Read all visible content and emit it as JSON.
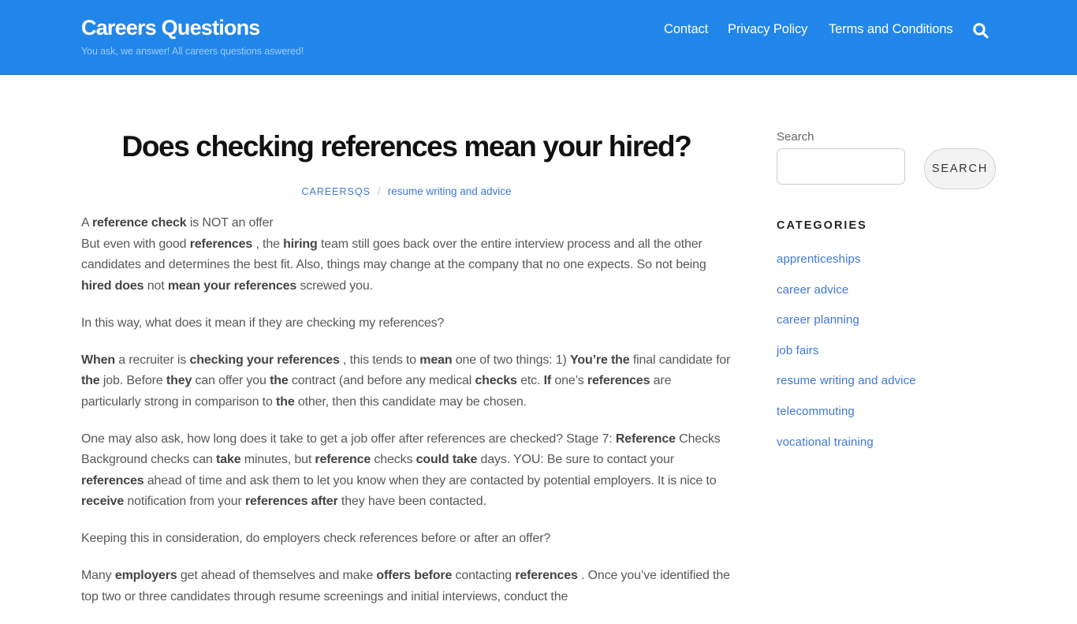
{
  "header": {
    "site_title": "Careers Questions",
    "tagline": "You ask, we answer! All careers questions aswered!",
    "nav": [
      {
        "label": "Contact"
      },
      {
        "label": "Privacy Policy"
      },
      {
        "label": "Terms and Conditions"
      }
    ],
    "search_icon": "search-icon",
    "colors": {
      "bar": "#2186ea",
      "tagline": "#9ccbfa"
    }
  },
  "article": {
    "title": "Does checking references mean your hired?",
    "meta": {
      "author": "CAREERSQS",
      "separator": "/",
      "category": "resume writing and advice"
    },
    "paragraphs": [
      [
        {
          "t": "A "
        },
        {
          "b": "reference check"
        },
        {
          "t": " is NOT an offer"
        },
        {
          "br": true
        },
        {
          "t": "But even with good "
        },
        {
          "b": "references"
        },
        {
          "t": " , the "
        },
        {
          "b": "hiring"
        },
        {
          "t": " team still goes back over the entire interview process and all the other candidates and determines the best fit. Also, things may change at the company that no one expects. So not being "
        },
        {
          "b": "hired does"
        },
        {
          "t": " not "
        },
        {
          "b": "mean your references"
        },
        {
          "t": " screwed you."
        }
      ],
      [
        {
          "t": "In this way, what does it mean if they are checking my references?"
        }
      ],
      [
        {
          "b": "When"
        },
        {
          "t": " a recruiter is "
        },
        {
          "b": "checking your references"
        },
        {
          "t": " , this tends to "
        },
        {
          "b": "mean"
        },
        {
          "t": " one of two things: 1) "
        },
        {
          "b": "You’re the"
        },
        {
          "t": " final candidate for "
        },
        {
          "b": "the"
        },
        {
          "t": " job. Before "
        },
        {
          "b": "they"
        },
        {
          "t": " can offer you "
        },
        {
          "b": "the"
        },
        {
          "t": " contract (and before any medical "
        },
        {
          "b": "checks"
        },
        {
          "t": " etc. "
        },
        {
          "b": "If"
        },
        {
          "t": " one’s "
        },
        {
          "b": "references"
        },
        {
          "t": " are particularly strong in comparison to "
        },
        {
          "b": "the"
        },
        {
          "t": " other, then this candidate may be chosen."
        }
      ],
      [
        {
          "t": "One may also ask, how long does it take to get a job offer after references are checked? Stage 7: "
        },
        {
          "b": "Reference"
        },
        {
          "t": " Checks Background checks can "
        },
        {
          "b": "take"
        },
        {
          "t": " minutes, but "
        },
        {
          "b": "reference"
        },
        {
          "t": " checks "
        },
        {
          "b": "could take"
        },
        {
          "t": " days. YOU: Be sure to contact your "
        },
        {
          "b": "references"
        },
        {
          "t": " ahead of time and ask them to let you know when they are contacted by potential employers. It is nice to "
        },
        {
          "b": "receive"
        },
        {
          "t": " notification from your "
        },
        {
          "b": "references after"
        },
        {
          "t": " they have been contacted."
        }
      ],
      [
        {
          "t": "Keeping this in consideration, do employers check references before or after an offer?"
        }
      ],
      [
        {
          "t": "Many "
        },
        {
          "b": "employers"
        },
        {
          "t": " get ahead of themselves and make "
        },
        {
          "b": "offers before"
        },
        {
          "t": " contacting "
        },
        {
          "b": "references"
        },
        {
          "t": " . Once you’ve identified the top two or three candidates through resume screenings and initial interviews, conduct the"
        }
      ]
    ]
  },
  "sidebar": {
    "search": {
      "label": "Search",
      "value": "",
      "placeholder": "",
      "button_label": "SEARCH"
    },
    "categories": {
      "title": "CATEGORIES",
      "items": [
        {
          "label": "apprenticeships"
        },
        {
          "label": "career advice"
        },
        {
          "label": "career planning"
        },
        {
          "label": "job fairs"
        },
        {
          "label": "resume writing and advice"
        },
        {
          "label": "telecommuting"
        },
        {
          "label": "vocational training"
        }
      ]
    },
    "link_color": "#3f78d3"
  }
}
